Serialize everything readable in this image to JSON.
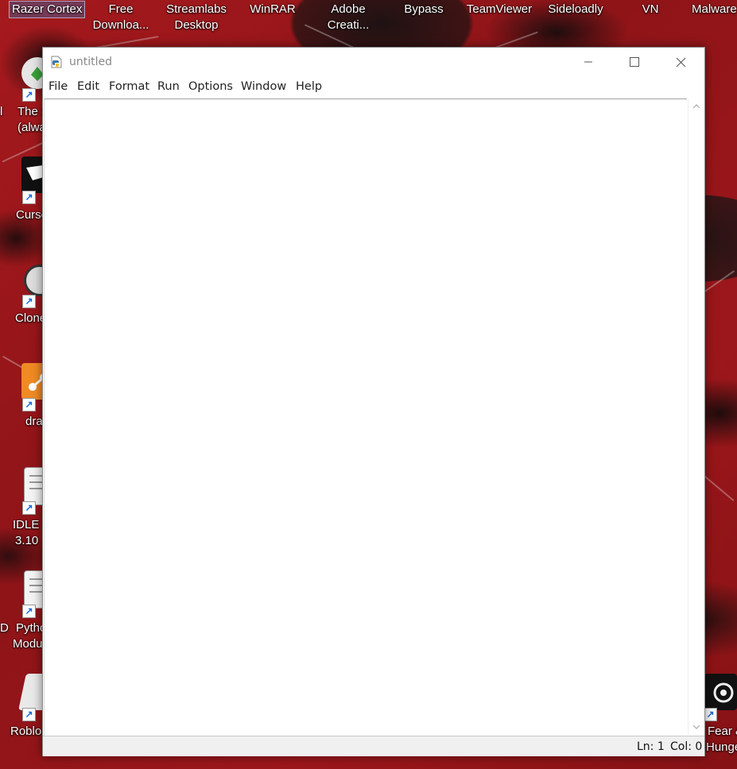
{
  "desktop": {
    "top_icons": [
      {
        "label": "Razer Cortex"
      },
      {
        "label": "Free\nDownloa..."
      },
      {
        "label": "Streamlabs\nDesktop"
      },
      {
        "label": "WinRAR"
      },
      {
        "label": "Adobe\nCreati..."
      },
      {
        "label": "Bypass"
      },
      {
        "label": "TeamViewer"
      },
      {
        "label": "Sideloadly"
      },
      {
        "label": "VN"
      },
      {
        "label": "Malware"
      }
    ],
    "left_icons": [
      {
        "label_line1": "The S",
        "label_line2": "(alwa"
      },
      {
        "label_line1": "Curse",
        "label_line2": ""
      },
      {
        "label_line1": "Clone",
        "label_line2": ""
      },
      {
        "label_line1": "dra",
        "label_line2": ""
      },
      {
        "label_line1": "IDLE (",
        "label_line2": "3.10 "
      },
      {
        "label_line1": "Pytho",
        "label_line2": "Modu"
      },
      {
        "label_line1": "Roblo",
        "label_line2": ""
      }
    ],
    "right_icon": {
      "label_line1": "Fear &",
      "label_line2": "Hunge"
    },
    "edge_left_text": [
      "l",
      "D"
    ]
  },
  "window": {
    "title": "untitled",
    "controls": {
      "minimize": "minimize-icon",
      "maximize": "maximize-icon",
      "close": "close-icon"
    },
    "menu": [
      "File",
      "Edit",
      "Format",
      "Run",
      "Options",
      "Window",
      "Help"
    ],
    "editor_text": "",
    "status": {
      "line": "Ln: 1",
      "col": "Col: 0"
    }
  }
}
